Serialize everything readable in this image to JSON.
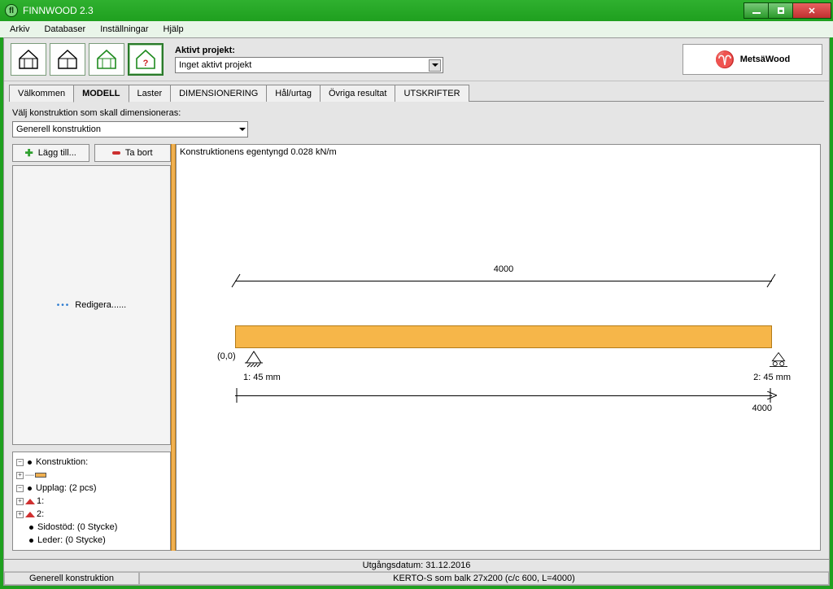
{
  "window": {
    "title": "FINNWOOD 2.3"
  },
  "menu": {
    "arkiv": "Arkiv",
    "databaser": "Databaser",
    "installningar": "Inställningar",
    "hjalp": "Hjälp"
  },
  "project": {
    "label": "Aktivt projekt:",
    "value": "Inget aktivt projekt"
  },
  "logo": {
    "text": "MetsäWood"
  },
  "tabs": {
    "valkommen": "Välkommen",
    "modell": "MODELL",
    "laster": "Laster",
    "dimensionering": "DIMENSIONERING",
    "hal": "Hål/urtag",
    "ovriga": "Övriga resultat",
    "utskrifter": "UTSKRIFTER"
  },
  "constr": {
    "label": "Välj konstruktion som skall dimensioneras:",
    "value": "Generell konstruktion"
  },
  "buttons": {
    "add": "Lägg till...",
    "remove": "Ta bort",
    "edit": "Redigera......"
  },
  "tree": {
    "konstruktion": "Konstruktion:",
    "upplag": "Upplag: (2 pcs)",
    "upp1": "1:",
    "upp2": "2:",
    "sidostod": "Sidostöd: (0 Stycke)",
    "leder": "Leder: (0 Stycke)"
  },
  "beam": {
    "self_weight": "Konstruktionens egentyngd 0.028 kN/m",
    "length_top": "4000",
    "origin": "(0,0)",
    "support1": "1: 45 mm",
    "support2": "2: 45 mm",
    "length_bot": "4000"
  },
  "status": {
    "date": "Utgångsdatum: 31.12.2016",
    "constr": "Generell konstruktion",
    "section": "KERTO-S som balk 27x200 (c/c 600, L=4000)"
  }
}
